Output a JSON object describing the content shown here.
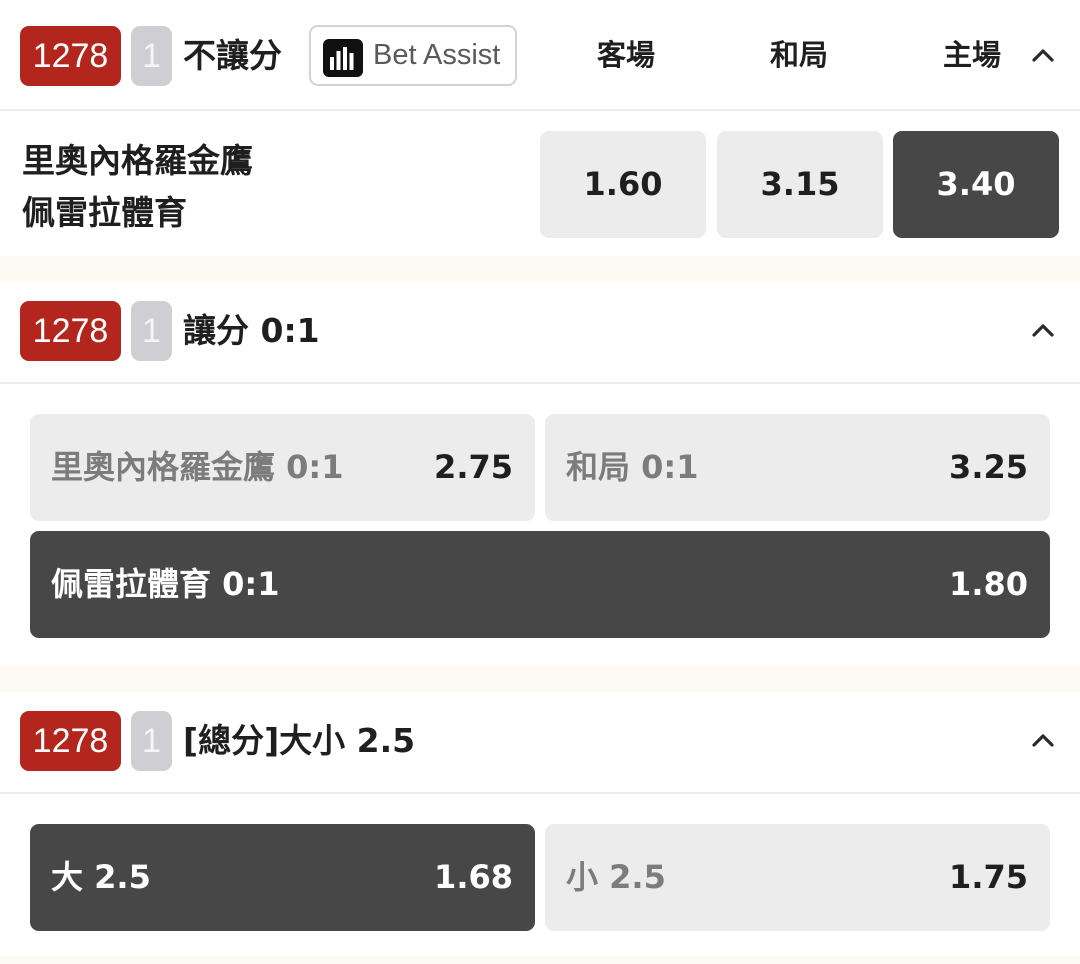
{
  "market_1x2": {
    "match_id": "1278",
    "leg": "1",
    "title": "不讓分",
    "bet_assist_label": "Bet Assist",
    "columns": [
      "客場",
      "和局",
      "主場"
    ],
    "teams": [
      "里奧內格羅金鷹",
      "佩雷拉體育"
    ],
    "odds": [
      "1.60",
      "3.15",
      "3.40"
    ],
    "selected_index": 2
  },
  "market_handicap": {
    "match_id": "1278",
    "leg": "1",
    "title": "讓分 0:1",
    "options": [
      {
        "label": "里奧內格羅金鷹 0:1",
        "odds": "2.75",
        "selected": false
      },
      {
        "label": "和局 0:1",
        "odds": "3.25",
        "selected": false
      },
      {
        "label": "佩雷拉體育 0:1",
        "odds": "1.80",
        "selected": true
      }
    ]
  },
  "market_total": {
    "match_id": "1278",
    "leg": "1",
    "title": "[總分]大小 2.5",
    "options": [
      {
        "label": "大 2.5",
        "odds": "1.68",
        "selected": true
      },
      {
        "label": "小 2.5",
        "odds": "1.75",
        "selected": false
      }
    ]
  },
  "icons": {
    "collapse": "chevron-up-icon",
    "bet_assist": "bar-chart-icon"
  },
  "colors": {
    "badge_red": "#b3261e",
    "badge_grey": "#cfcfd3",
    "selected_bg": "#474747",
    "unselected_bg": "#ececec",
    "page_bg": "#fcfaf2"
  }
}
